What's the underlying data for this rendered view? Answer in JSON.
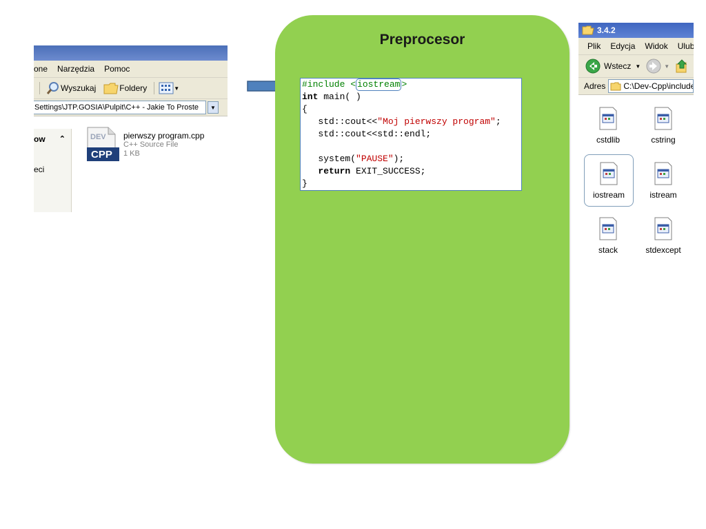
{
  "slide": {
    "title": "Preprocesor"
  },
  "left_explorer": {
    "menu": [
      "one",
      "Narzędzia",
      "Pomoc"
    ],
    "toolbar": {
      "search_label": "Wyszukaj",
      "folders_label": "Foldery"
    },
    "address": "Settings\\JTP.GOSIA\\Pulpit\\C++ - Jakie To Proste",
    "pane": {
      "header": "ow",
      "item": "eci"
    },
    "file": {
      "icon_label": "CPP",
      "name": "pierwszy program.cpp",
      "type": "C++ Source File",
      "size": "1 KB"
    }
  },
  "code": {
    "include_directive": "#include <",
    "include_header": "iostream",
    "include_close": ">",
    "line2_kw": "int",
    "line2_rest": " main( )",
    "line3": "{",
    "line4_pre": "   std::cout<<",
    "line4_str": "\"Moj pierwszy program\"",
    "line4_post": ";",
    "line5": "   std::cout<<std::endl;",
    "line7_pre": "   system(",
    "line7_str": "\"PAUSE\"",
    "line7_post": ");",
    "line8_kw": "   return",
    "line8_rest": " EXIT_SUCCESS;",
    "line9": "}"
  },
  "right_explorer": {
    "title": "3.4.2",
    "menu": [
      "Plik",
      "Edycja",
      "Widok",
      "Ulub"
    ],
    "toolbar": {
      "back_label": "Wstecz"
    },
    "address_label": "Adres",
    "address": "C:\\Dev-Cpp\\include",
    "files": [
      "cstdlib",
      "cstring",
      "iostream",
      "istream",
      "stack",
      "stdexcept"
    ]
  },
  "colors": {
    "panel_green": "#92d050",
    "arrow_blue": "#4f81bd",
    "code_string": "#c00000",
    "code_preprocessor": "#008000"
  }
}
